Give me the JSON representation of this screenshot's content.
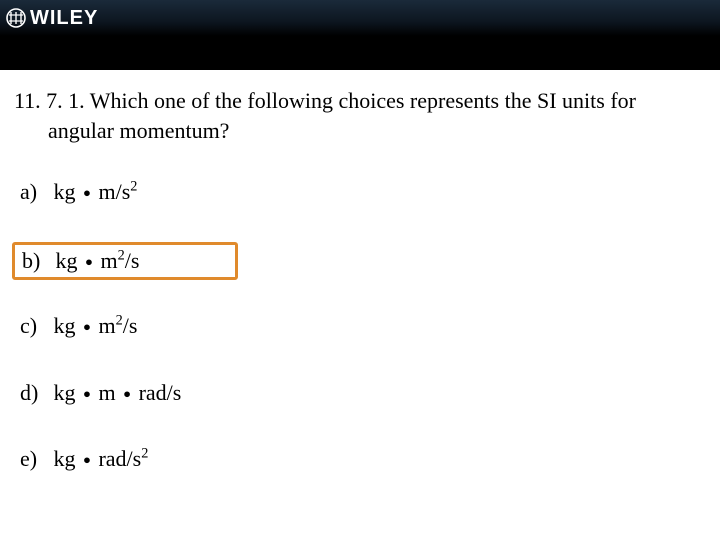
{
  "brand": {
    "name": "WILEY"
  },
  "question": {
    "prefix": "11. 7. 1. ",
    "line1": "Which one of the following choices represents the SI units for",
    "line2": "angular momentum?"
  },
  "choices": {
    "a": {
      "label": "a)",
      "base": "kg",
      "unit_prefix": "m/s",
      "sup": "2",
      "unit_suffix": ""
    },
    "b": {
      "label": "b)",
      "base": "kg",
      "unit_prefix": "m",
      "sup": "2",
      "unit_suffix": "/s"
    },
    "c": {
      "label": "c)",
      "base": "kg",
      "unit_prefix": "m",
      "sup": "2",
      "unit_suffix": "/s"
    },
    "d": {
      "label": "d)",
      "base": "kg",
      "mid": "m",
      "tail": "rad/s"
    },
    "e": {
      "label": "e)",
      "base": "kg",
      "unit_prefix": "rad/s",
      "sup": "2",
      "unit_suffix": ""
    }
  },
  "highlight_key": "b",
  "colors": {
    "highlight_border": "#e08a2c",
    "header_dark": "#0d1620"
  }
}
